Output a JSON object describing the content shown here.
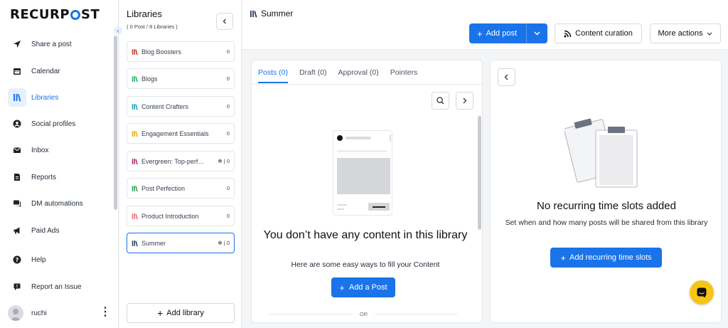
{
  "brand": {
    "logo_text": "RECURPOST",
    "accent": "#1a73e8",
    "chat_color": "#f5c518"
  },
  "nav": {
    "items": [
      {
        "label": "Share a post",
        "icon": "send-icon"
      },
      {
        "label": "Calendar",
        "icon": "calendar-icon"
      },
      {
        "label": "Libraries",
        "icon": "libraries-icon",
        "active": true
      },
      {
        "label": "Social profiles",
        "icon": "profile-icon"
      },
      {
        "label": "Inbox",
        "icon": "inbox-icon"
      },
      {
        "label": "Reports",
        "icon": "reports-icon"
      },
      {
        "label": "DM automations",
        "icon": "chat-icon"
      },
      {
        "label": "Paid Ads",
        "icon": "megaphone-icon"
      },
      {
        "label": "Help",
        "icon": "help-icon"
      },
      {
        "label": "Report an Issue",
        "icon": "flag-icon"
      }
    ],
    "user": {
      "name": "ruchi"
    }
  },
  "libraries": {
    "title": "Libraries",
    "subtitle": "( 0 Post / 8 Libraries )",
    "items": [
      {
        "name": "Blog Boosters",
        "count": "0",
        "color": "#c0392b"
      },
      {
        "name": "Blogs",
        "count": "0",
        "color": "#27ae60"
      },
      {
        "name": "Content Crafters",
        "count": "0",
        "color": "#16a2b8"
      },
      {
        "name": "Engagement Essentials",
        "count": "0",
        "color": "#e6a817"
      },
      {
        "name": "Evergreen: Top-perf…",
        "count": "✻ | 0",
        "color": "#b0306a"
      },
      {
        "name": "Post Perfection",
        "count": "0",
        "color": "#2e9e5b"
      },
      {
        "name": "Product Introduction",
        "count": "0",
        "color": "#e57373"
      },
      {
        "name": "Summer",
        "count": "✻ | 0",
        "color": "#2c3e6b",
        "active": true
      }
    ],
    "add_label": "Add library"
  },
  "header": {
    "title": "Summer",
    "add_post_label": "Add post",
    "content_curation_label": "Content curation",
    "more_actions_label": "More actions"
  },
  "content": {
    "tabs": [
      "Posts (0)",
      "Draft (0)",
      "Approval (0)",
      "Pointers"
    ],
    "empty_title": "You don’t have any content in this library",
    "empty_sub": "Here are some easy ways to fill your Content",
    "add_post_label": "Add a Post",
    "or_label": "OR"
  },
  "slots": {
    "title": "No recurring time slots added",
    "subtitle": "Set when and how many posts will be shared from this library",
    "button_label": "Add recurring time slots"
  }
}
